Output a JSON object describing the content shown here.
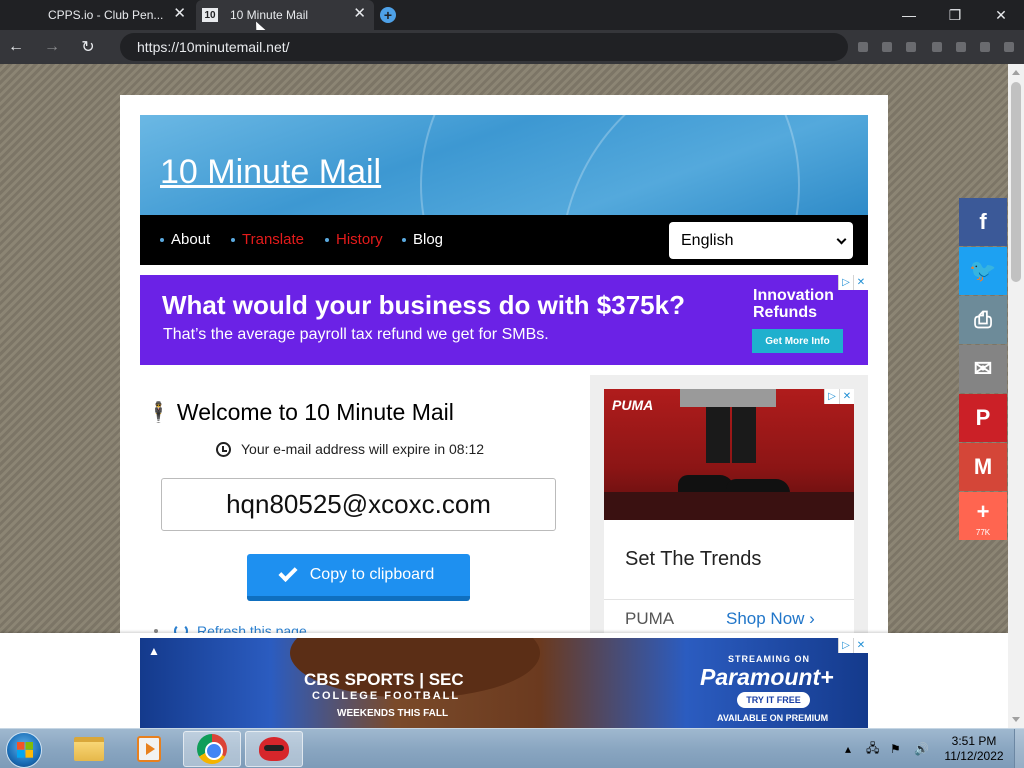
{
  "browser": {
    "tabs": [
      {
        "title": "CPPS.io - Club Pen..."
      },
      {
        "title": "10 Minute Mail",
        "favicon": "10"
      }
    ],
    "url": "https://10minutemail.net/",
    "window_controls": {
      "minimize": "—",
      "restore": "❐",
      "close": "✕"
    }
  },
  "site": {
    "title": "10 Minute Mail",
    "nav": [
      {
        "label": "About",
        "color": "#ffffff"
      },
      {
        "label": "Translate",
        "color": "#e31b1b"
      },
      {
        "label": "History",
        "color": "#e31b1b"
      },
      {
        "label": "Blog",
        "color": "#ffffff"
      }
    ],
    "language": "English"
  },
  "ad_top": {
    "headline": "What would your business do with $375k?",
    "subline": "That’s the average payroll tax refund we get for SMBs.",
    "side_title_1": "Innovation",
    "side_title_2": "Refunds",
    "cta": "Get More Info"
  },
  "main": {
    "welcome": "Welcome to 10 Minute Mail",
    "expire_text": "Your e-mail address will expire in 08:12",
    "email": "hqn80525@xcoxc.com",
    "copy_button": "Copy to clipboard",
    "refresh_link": "Refresh this page"
  },
  "ad_side": {
    "brand_logo": "PUMA",
    "headline": "Set The Trends",
    "advertiser": "PUMA",
    "cta": "Shop Now"
  },
  "social": [
    {
      "icon": "facebook-icon",
      "glyph": "f",
      "color": "#3b5998"
    },
    {
      "icon": "twitter-icon",
      "glyph": "🐦",
      "color": "#1da1f2"
    },
    {
      "icon": "print-icon",
      "glyph": "⎙",
      "color": "#6d8b99"
    },
    {
      "icon": "email-icon",
      "glyph": "✉",
      "color": "#848484"
    },
    {
      "icon": "pinterest-icon",
      "glyph": "P",
      "color": "#cb2027"
    },
    {
      "icon": "gmail-icon",
      "glyph": "M",
      "color": "#d44638"
    },
    {
      "icon": "share-plus-icon",
      "glyph": "+",
      "color": "#ff6550",
      "count": "77K"
    }
  ],
  "ad_bottom": {
    "brand": "CBS SPORTS | SEC",
    "line2": "COLLEGE FOOTBALL",
    "line3": "WEEKENDS THIS FALL",
    "streaming": "STREAMING ON",
    "service": "Paramount+",
    "cta": "TRY IT FREE",
    "tagline": "AVAILABLE ON PREMIUM"
  },
  "taskbar": {
    "time": "3:51 PM",
    "date": "11/12/2022"
  }
}
